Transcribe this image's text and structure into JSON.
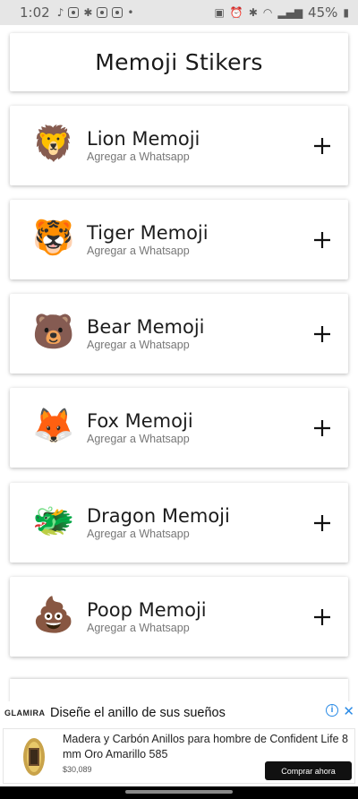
{
  "status_bar": {
    "time": "1:02",
    "battery": "45%"
  },
  "header": {
    "title": "Memoji Stikers"
  },
  "items": [
    {
      "name": "Lion Memoji",
      "subtitle": "Agregar a Whatsapp",
      "emoji": "🦁",
      "icon": "lion-icon"
    },
    {
      "name": "Tiger Memoji",
      "subtitle": "Agregar a Whatsapp",
      "emoji": "🐯",
      "icon": "tiger-icon"
    },
    {
      "name": "Bear Memoji",
      "subtitle": "Agregar a Whatsapp",
      "emoji": "🐻",
      "icon": "bear-icon"
    },
    {
      "name": "Fox Memoji",
      "subtitle": "Agregar a Whatsapp",
      "emoji": "🦊",
      "icon": "fox-icon"
    },
    {
      "name": "Dragon Memoji",
      "subtitle": "Agregar a Whatsapp",
      "emoji": "🐲",
      "icon": "dragon-icon"
    },
    {
      "name": "Poop Memoji",
      "subtitle": "Agregar a Whatsapp",
      "emoji": "💩",
      "icon": "poop-icon"
    }
  ],
  "ad": {
    "brand": "GLAMIRA",
    "headline": "Diseñe el anillo de sus sueños",
    "description": "Madera y Carbón Anillos para hombre de Confident Life 8 mm Oro Amarillo 585",
    "price": "$30,089",
    "cta": "Comprar ahora",
    "accent_color": "#2b8be6"
  }
}
